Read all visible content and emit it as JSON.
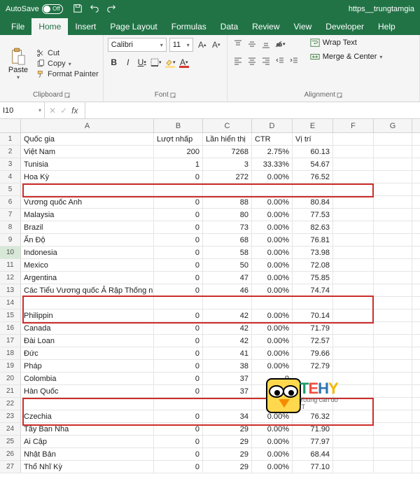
{
  "titlebar": {
    "autosave": "AutoSave",
    "off": "Off",
    "doc": "https__trungtamgia"
  },
  "tabs": [
    "File",
    "Home",
    "Insert",
    "Page Layout",
    "Formulas",
    "Data",
    "Review",
    "View",
    "Developer",
    "Help"
  ],
  "active_tab": 1,
  "ribbon": {
    "paste": "Paste",
    "cut": "Cut",
    "copy": "Copy",
    "format_painter": "Format Painter",
    "clipboard": "Clipboard",
    "font_name": "Calibri",
    "font_size": "11",
    "font_group": "Font",
    "wrap": "Wrap Text",
    "merge": "Merge & Center",
    "align_group": "Alignment"
  },
  "namebox": "I10",
  "columns": [
    {
      "letter": "A",
      "w": "wA"
    },
    {
      "letter": "B",
      "w": "wB"
    },
    {
      "letter": "C",
      "w": "wC"
    },
    {
      "letter": "D",
      "w": "wD"
    },
    {
      "letter": "E",
      "w": "wE"
    },
    {
      "letter": "F",
      "w": "wF"
    },
    {
      "letter": "G",
      "w": "wG"
    }
  ],
  "header_row": [
    "Quốc gia",
    "Lượt nhấp",
    "Lần hiển thị",
    "CTR",
    "Vị trí"
  ],
  "rows": [
    {
      "n": 1,
      "a": "Quốc gia",
      "b": "Lượt nhấp",
      "c": "Lần hiển thị",
      "d": "CTR",
      "e": "Vị trí"
    },
    {
      "n": 2,
      "a": "Việt Nam",
      "b": "200",
      "c": "7268",
      "d": "2.75%",
      "e": "60.13"
    },
    {
      "n": 3,
      "a": "Tunisia",
      "b": "1",
      "c": "3",
      "d": "33.33%",
      "e": "54.67"
    },
    {
      "n": 4,
      "a": "Hoa Kỳ",
      "b": "0",
      "c": "272",
      "d": "0.00%",
      "e": "76.52"
    },
    {
      "n": 5,
      "a": "",
      "b": "",
      "c": "",
      "d": "",
      "e": ""
    },
    {
      "n": 6,
      "a": "Vương quốc Anh",
      "b": "0",
      "c": "88",
      "d": "0.00%",
      "e": "80.84"
    },
    {
      "n": 7,
      "a": "Malaysia",
      "b": "0",
      "c": "80",
      "d": "0.00%",
      "e": "77.53"
    },
    {
      "n": 8,
      "a": "Brazil",
      "b": "0",
      "c": "73",
      "d": "0.00%",
      "e": "82.63"
    },
    {
      "n": 9,
      "a": "Ấn Độ",
      "b": "0",
      "c": "68",
      "d": "0.00%",
      "e": "76.81"
    },
    {
      "n": 10,
      "a": "Indonesia",
      "b": "0",
      "c": "58",
      "d": "0.00%",
      "e": "73.98",
      "sel": true
    },
    {
      "n": 11,
      "a": "Mexico",
      "b": "0",
      "c": "50",
      "d": "0.00%",
      "e": "72.08"
    },
    {
      "n": 12,
      "a": "Argentina",
      "b": "0",
      "c": "47",
      "d": "0.00%",
      "e": "75.85"
    },
    {
      "n": 13,
      "a": "Các Tiểu Vương quốc Ả Rập Thống nhất",
      "b": "0",
      "c": "46",
      "d": "0.00%",
      "e": "74.74"
    },
    {
      "n": 14,
      "a": "",
      "b": "",
      "c": "",
      "d": "",
      "e": ""
    },
    {
      "n": 15,
      "a": "Philippin",
      "b": "0",
      "c": "42",
      "d": "0.00%",
      "e": "70.14"
    },
    {
      "n": 16,
      "a": "Canada",
      "b": "0",
      "c": "42",
      "d": "0.00%",
      "e": "71.79"
    },
    {
      "n": 17,
      "a": "Đài Loan",
      "b": "0",
      "c": "42",
      "d": "0.00%",
      "e": "72.57"
    },
    {
      "n": 18,
      "a": "Đức",
      "b": "0",
      "c": "41",
      "d": "0.00%",
      "e": "79.66"
    },
    {
      "n": 19,
      "a": "Pháp",
      "b": "0",
      "c": "38",
      "d": "0.00%",
      "e": "72.79"
    },
    {
      "n": 20,
      "a": "Colombia",
      "b": "0",
      "c": "37",
      "d": "0",
      "e": ""
    },
    {
      "n": 21,
      "a": "Hàn Quốc",
      "b": "0",
      "c": "37",
      "d": "0",
      "e": ""
    },
    {
      "n": 22,
      "a": "",
      "b": "",
      "c": "",
      "d": "",
      "e": ""
    },
    {
      "n": 23,
      "a": "Czechia",
      "b": "0",
      "c": "34",
      "d": "0.00%",
      "e": "76.32"
    },
    {
      "n": 24,
      "a": "Tây Ban Nha",
      "b": "0",
      "c": "29",
      "d": "0.00%",
      "e": "71.90"
    },
    {
      "n": 25,
      "a": "Ai Cập",
      "b": "0",
      "c": "29",
      "d": "0.00%",
      "e": "77.97"
    },
    {
      "n": 26,
      "a": "Nhật Bản",
      "b": "0",
      "c": "29",
      "d": "0.00%",
      "e": "68.44"
    },
    {
      "n": 27,
      "a": "Thổ Nhĩ Kỳ",
      "b": "0",
      "c": "29",
      "d": "0.00%",
      "e": "77.10"
    }
  ],
  "logo": {
    "brand": "TEHY",
    "tag": "Young can do IT"
  }
}
